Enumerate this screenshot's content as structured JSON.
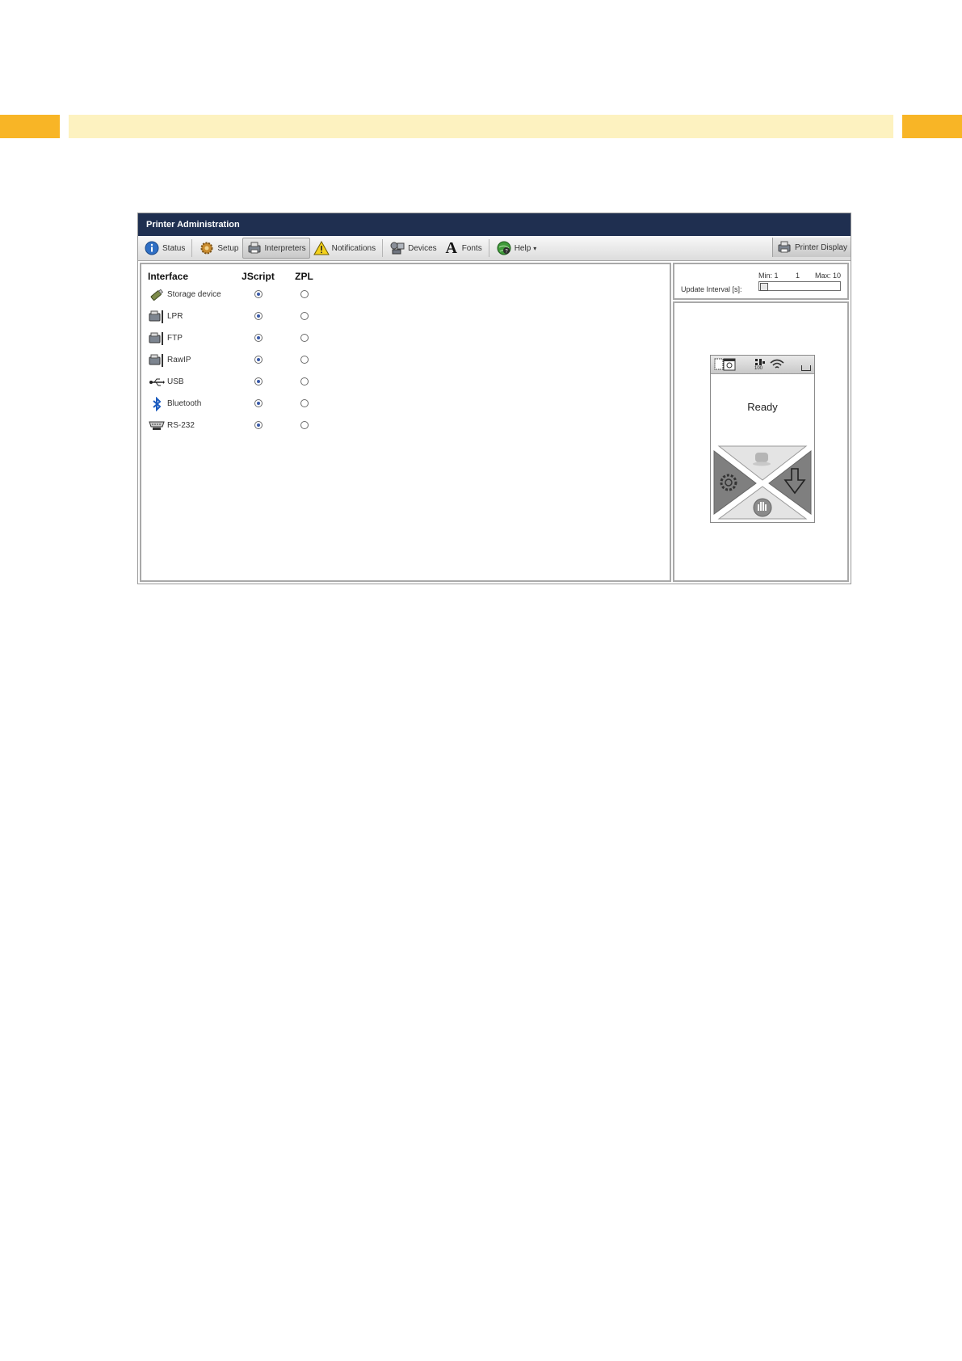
{
  "window": {
    "title": "Printer Administration"
  },
  "toolbar": {
    "items": [
      {
        "label": "Status",
        "icon": "info-icon"
      },
      {
        "label": "Setup",
        "icon": "gear-icon"
      },
      {
        "label": "Interpreters",
        "icon": "printer-icon",
        "active": true
      },
      {
        "label": "Notifications",
        "icon": "warning-icon"
      },
      {
        "label": "Devices",
        "icon": "devices-icon"
      },
      {
        "label": "Fonts",
        "icon": "font-icon"
      },
      {
        "label": "Help",
        "icon": "help-globe-icon",
        "dropdown": "▾"
      }
    ],
    "printer_display": "Printer Display"
  },
  "interpreters": {
    "headers": {
      "interface": "Interface",
      "jscript": "JScript",
      "zpl": "ZPL"
    },
    "rows": [
      {
        "name": "Storage device",
        "icon": "usb-stick-icon",
        "selected": "jscript"
      },
      {
        "name": "LPR",
        "icon": "network-printer-icon",
        "selected": "jscript"
      },
      {
        "name": "FTP",
        "icon": "network-printer-icon",
        "selected": "jscript"
      },
      {
        "name": "RawIP",
        "icon": "network-printer-icon",
        "selected": "jscript"
      },
      {
        "name": "USB",
        "icon": "usb-icon",
        "selected": "jscript"
      },
      {
        "name": "Bluetooth",
        "icon": "bluetooth-icon",
        "selected": "jscript"
      },
      {
        "name": "RS-232",
        "icon": "serial-port-icon",
        "selected": "jscript"
      }
    ]
  },
  "update_interval": {
    "label": "Update Interval [s]:",
    "min_label": "Min: 1",
    "value": "1",
    "max_label": "Max: 10",
    "min": 1,
    "max": 10,
    "current": 1
  },
  "printer_display": {
    "status_text": "Ready",
    "signal_value": "100"
  },
  "colors": {
    "band_orange": "#f8b526",
    "band_light": "#fdf2c0",
    "titlebar": "#1f2f50"
  }
}
